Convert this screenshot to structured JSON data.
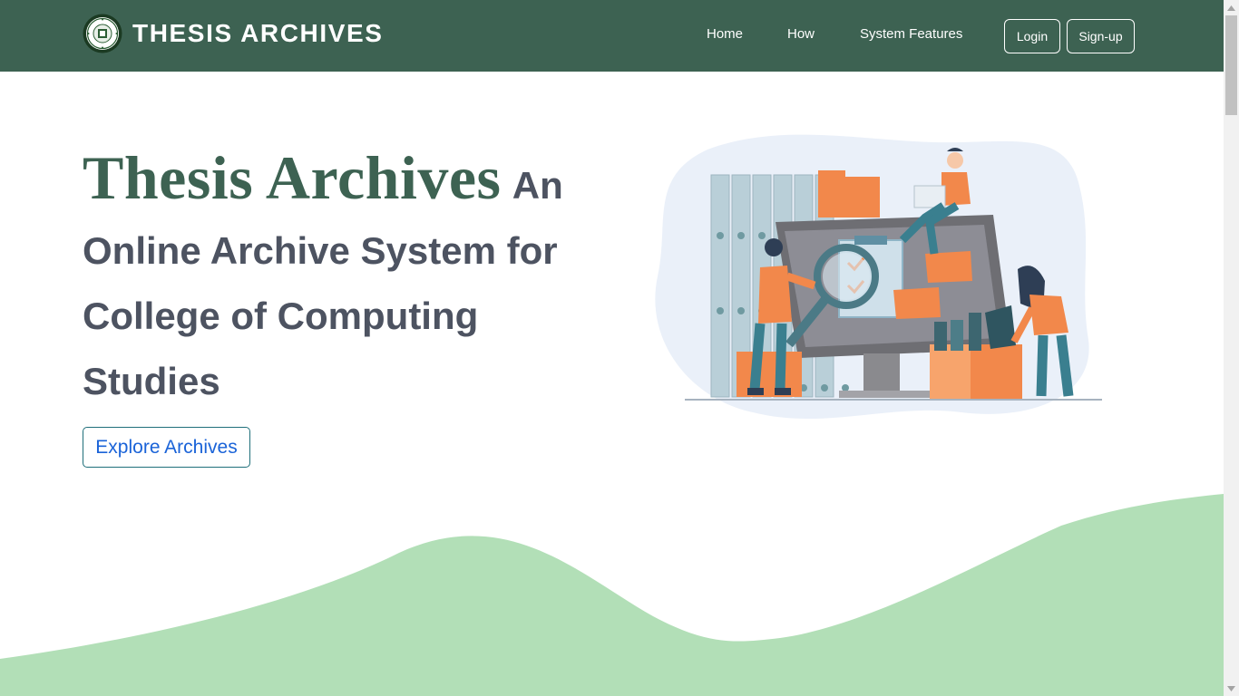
{
  "navbar": {
    "brand_title": "THESIS ARCHIVES",
    "logo_icon": "college-seal-logo",
    "links": [
      {
        "label": "Home"
      },
      {
        "label": "How"
      },
      {
        "label": "System Features"
      }
    ],
    "login_label": "Login",
    "signup_label": "Sign-up"
  },
  "hero": {
    "brand": "Thesis Archives",
    "line1": "An",
    "line2": "Online Archive System for",
    "line3": "College of Computing",
    "line4": "Studies",
    "cta_label": "Explore Archives",
    "illustration_icon": "archive-illustration"
  },
  "colors": {
    "primary": "#3d6252",
    "text": "#4d5361",
    "accent_link": "#1a63d8",
    "wave": "#b2dfb7",
    "orange": "#f2884b"
  }
}
